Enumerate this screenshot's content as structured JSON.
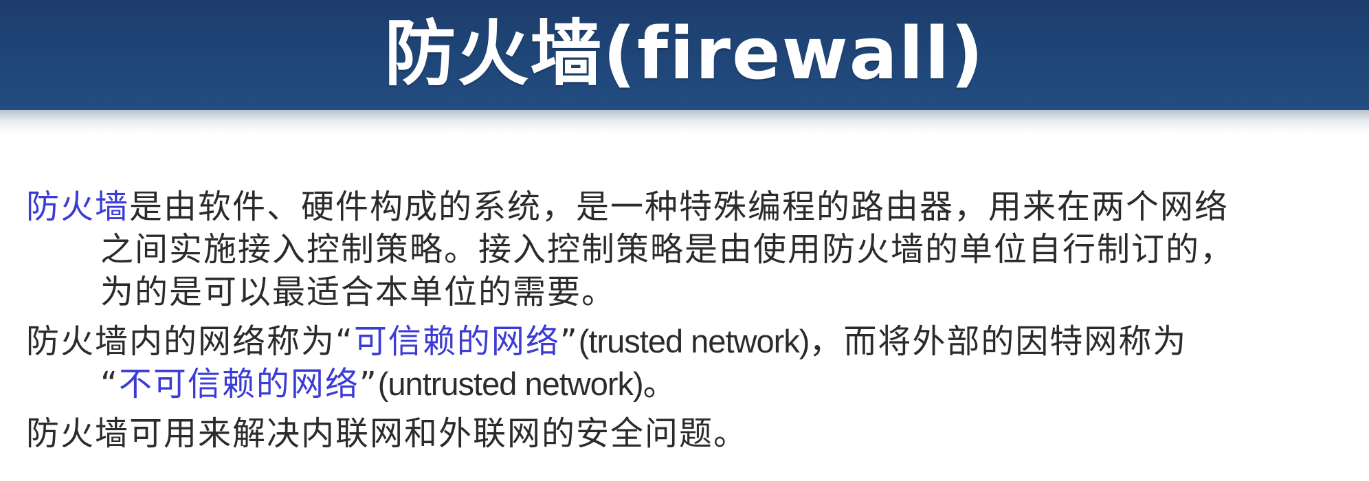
{
  "title": "防火墙(firewall)",
  "para1": {
    "lead_highlight": "防火墙",
    "line1_rest": "是由软件、硬件构成的系统，是一种特殊编程的路由器，用来在两个网络",
    "line2": "之间实施接入控制策略。接入控制策略是由使用防火墙的单位自行制订的，",
    "line3": "为的是可以最适合本单位的需要。"
  },
  "para2": {
    "line1_start": "防火墙内的网络称为“",
    "line1_highlight": "可信赖的网络",
    "line1_quote_end": "”",
    "line1_english": "(trusted network)",
    "line1_end": "，而将外部的因特网称为",
    "line2_quote_start": "“",
    "line2_highlight": "不可信赖的网络",
    "line2_quote_end": "”",
    "line2_english": "(untrusted network)",
    "line2_end": "。"
  },
  "para3": {
    "line1": "防火墙可用来解决内联网和外联网的安全问题。"
  },
  "colors": {
    "title_bar": "#1f4678",
    "title_text": "#ffffff",
    "body_text": "#2b2b2b",
    "highlight_text": "#3b3bd6"
  }
}
